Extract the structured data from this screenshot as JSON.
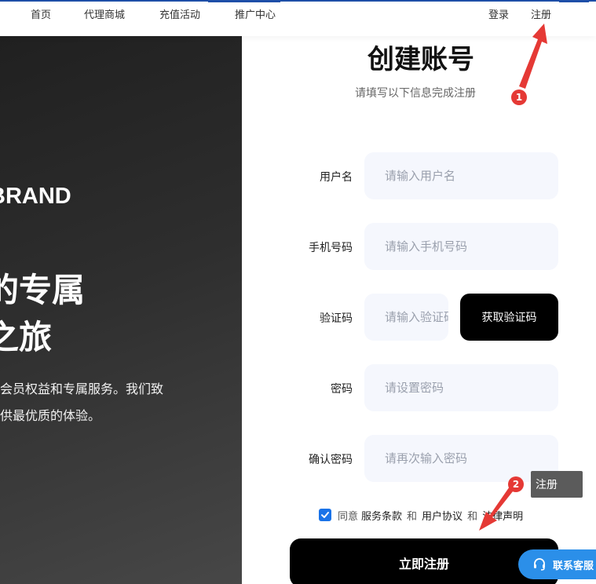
{
  "nav": {
    "items": [
      {
        "label": "首页"
      },
      {
        "label": "代理商城"
      },
      {
        "label": "充值活动"
      },
      {
        "label": "推广中心"
      }
    ],
    "login_label": "登录",
    "register_label": "注册"
  },
  "hero": {
    "brand": "BRAND",
    "title_line1": "的专属",
    "title_line2": "之旅",
    "desc_line1": "的会员权益和专属服务。我们致",
    "desc_line2": "提供最优质的体验。"
  },
  "form": {
    "title": "创建账号",
    "subtitle": "请填写以下信息完成注册",
    "fields": {
      "username": {
        "label": "用户名",
        "placeholder": "请输入用户名"
      },
      "phone": {
        "label": "手机号码",
        "placeholder": "请输入手机号码"
      },
      "code": {
        "label": "验证码",
        "placeholder": "请输入验证码"
      },
      "password": {
        "label": "密码",
        "placeholder": "请设置密码"
      },
      "confirm": {
        "label": "确认密码",
        "placeholder": "请再次输入密码"
      }
    },
    "get_code_label": "获取验证码",
    "agree": {
      "checked": true,
      "prefix": "同意",
      "terms": "服务条款",
      "and1": "和",
      "agreement": "用户协议",
      "and2": "和",
      "legal": "法律声明"
    },
    "submit_label": "立即注册"
  },
  "contact": {
    "label": "联系客服"
  },
  "annotations": {
    "step1": "1",
    "step2": "2",
    "tooltip": "注册",
    "arrow_color": "#e53935"
  },
  "colors": {
    "accent_blue": "#1e4fa8",
    "checkbox_blue": "#1a73e8",
    "contact_blue": "#2b8fe9",
    "button_black": "#000000",
    "input_bg": "#f5f7fd"
  }
}
